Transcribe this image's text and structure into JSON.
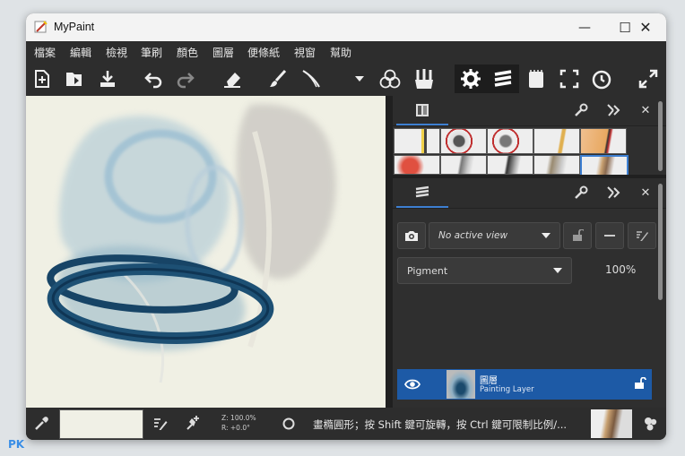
{
  "window": {
    "title": "MyPaint",
    "minimize": "—",
    "maximize": "☐",
    "close": "✕"
  },
  "menu": [
    "檔案",
    "編輯",
    "檢視",
    "筆刷",
    "顏色",
    "圖層",
    "便條紙",
    "視窗",
    "幫助"
  ],
  "toolbar": {
    "icons": [
      "new-file-icon",
      "open-file-icon",
      "save-icon",
      "undo-icon",
      "redo-icon",
      "eraser-icon",
      "brush-icon",
      "calligraphy-icon",
      "dropdown-icon",
      "color-circles-icon",
      "brush-set-icon",
      "settings-icon",
      "layers-icon",
      "scratchpad-icon",
      "fullscreen-icon",
      "history-icon",
      "expand-icon"
    ]
  },
  "brush_panel": {
    "close": "✕"
  },
  "layers_panel": {
    "view_select": "No active view",
    "mode_select": "Pigment",
    "opacity": "100%",
    "close": "✕",
    "layer": {
      "name": "圖層",
      "type": "Painting Layer"
    }
  },
  "statusbar": {
    "zoom": "Z: 100.0%",
    "rotation": "R: +0.0°",
    "hint": "畫橢圓形；按 Shift 鍵可旋轉，按 Ctrl 鍵可限制比例/..."
  },
  "watermark": "PK",
  "colors": {
    "accent": "#3d7fd1",
    "layer_selected": "#1d5aa6",
    "paint": "#1a4a6c"
  }
}
